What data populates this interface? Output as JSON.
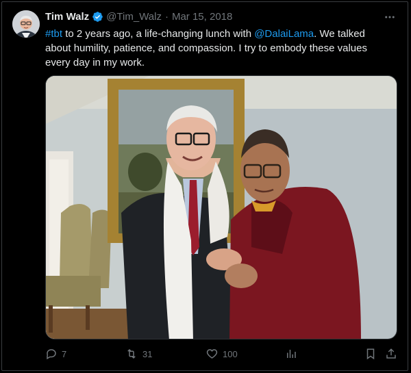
{
  "tweet": {
    "author_name": "Tim Walz",
    "handle": "@Tim_Walz",
    "separator": "·",
    "date": "Mar 15, 2018",
    "text": {
      "hashtag": "#tbt",
      "part1": " to 2 years ago, a life-changing lunch with ",
      "mention": "@DalaiLama",
      "part2": ". We talked about humility, patience, and compassion. I try to embody these values every day in my work."
    }
  },
  "actions": {
    "replies": "7",
    "retweets": "31",
    "likes": "100"
  },
  "icons": {
    "verified": "verified-badge-icon",
    "more": "more-horizontal-icon",
    "reply": "reply-icon",
    "retweet": "retweet-icon",
    "like": "heart-icon",
    "views": "views-chart-icon",
    "bookmark": "bookmark-icon",
    "share": "share-icon"
  },
  "colors": {
    "background": "#000000",
    "text": "#e7e9ea",
    "muted": "#71767b",
    "link": "#1d9bf0",
    "verified": "#1d9bf0"
  }
}
